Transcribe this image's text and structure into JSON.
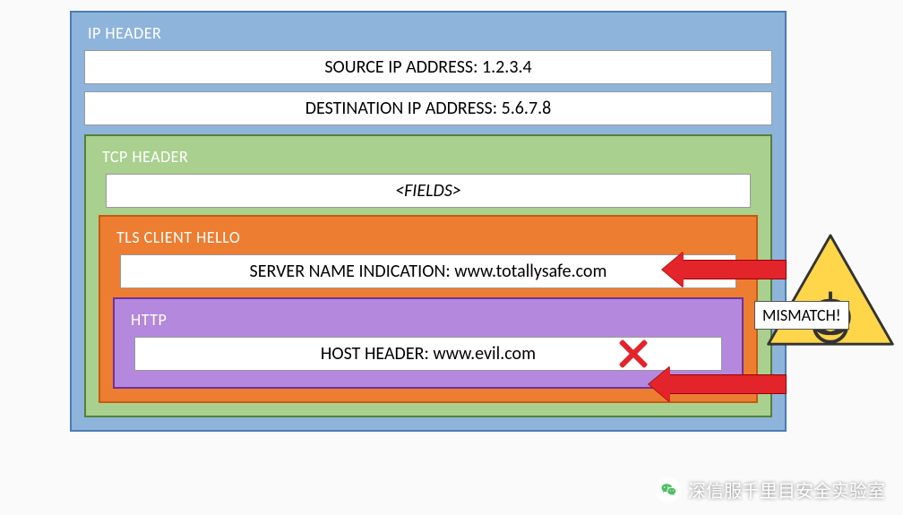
{
  "ip": {
    "title": "IP HEADER",
    "source": "SOURCE IP ADDRESS: 1.2.3.4",
    "destination": "DESTINATION IP ADDRESS: 5.6.7.8"
  },
  "tcp": {
    "title": "TCP HEADER",
    "fields": "<FIELDS>"
  },
  "tls": {
    "title": "TLS CLIENT HELLO",
    "sni": "SERVER NAME INDICATION: www.totallysafe.com"
  },
  "http": {
    "title": "HTTP",
    "host": "HOST HEADER: www.evil.com"
  },
  "annotation": {
    "mismatch": "MISMATCH!"
  },
  "watermark": {
    "text": "深信服千里目安全实验室"
  }
}
